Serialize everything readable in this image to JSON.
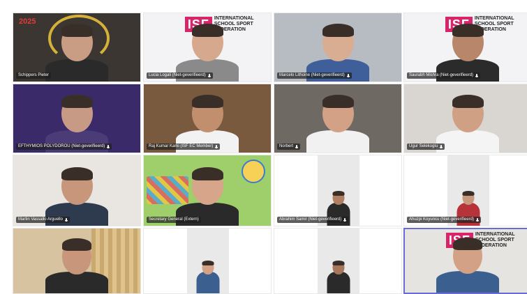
{
  "participants": [
    {
      "name": "Schippers Pieter",
      "mic": false,
      "muted": false,
      "bg": "#3b3632",
      "skin": "#c99d84",
      "shirt": "#2a2a2a",
      "overlay": "2025"
    },
    {
      "name": "Lucia Logali (Niet-geverifieerd)",
      "mic": true,
      "bg": "#f3f2f4",
      "skin": "#d6a98e",
      "shirt": "#8a8a8a",
      "isf": true
    },
    {
      "name": "Marcelo Lithoine (Niet-geverifieerd)",
      "mic": true,
      "bg": "#b7bcc3",
      "skin": "#d9ad92",
      "shirt": "#3f5f9a"
    },
    {
      "name": "Saurabh Mishra (Niet-geverifieerd)",
      "mic": true,
      "bg": "#f3f2f4",
      "skin": "#b8866a",
      "shirt": "#2b2b2b",
      "isf": true
    },
    {
      "name": "EFTHYMIOS POLYDOROU (Niet-geverifieerd)",
      "mic": true,
      "bg": "#3a2a6a",
      "skin": "#c79a86",
      "shirt": "#4b3c78"
    },
    {
      "name": "Raj Kumar Karki (ISF EC Member)",
      "mic": true,
      "bg": "#7a5a3e",
      "skin": "#c28f6e",
      "shirt": "#f2f2f2"
    },
    {
      "name": "Norbert",
      "mic": true,
      "bg": "#6e6a63",
      "skin": "#d3a286",
      "shirt": "#f1f1f1"
    },
    {
      "name": "Ugur Selekoglu",
      "mic": true,
      "bg": "#d9d5d0",
      "skin": "#d0a084",
      "shirt": "#f4f4f4"
    },
    {
      "name": "Martin Vassallo Arguello",
      "mic": true,
      "bg": "#e9e6e1",
      "skin": "#c8977b",
      "shirt": "#2e3b4f"
    },
    {
      "name": "Secretary General (Extern)",
      "mic": false,
      "bg": "#9fcf6a",
      "skin": "#d6a58a",
      "shirt": "#2a2a2a",
      "sticker": true
    },
    {
      "name": "Abrahim Samir (Niet-geverifieerd)",
      "mic": true,
      "bg": "#ffffff",
      "skin": "#b07f62",
      "shirt": "#2a2a2a",
      "inset": true
    },
    {
      "name": "Ahuzpi Koyuncu (Niet-geverifieerd)",
      "mic": true,
      "bg": "#ffffff",
      "skin": "#c8987c",
      "shirt": "#b8323a",
      "inset": true
    },
    {
      "name": "",
      "mic": false,
      "bg": "#d8c3a0",
      "skin": "#c8977b",
      "shirt": "#2a2a2a",
      "curtain": true
    },
    {
      "name": "",
      "mic": false,
      "bg": "#ffffff",
      "skin": "#d3a286",
      "shirt": "#3b5f8f",
      "inset": true
    },
    {
      "name": "",
      "mic": false,
      "bg": "#ffffff",
      "skin": "#a8765a",
      "shirt": "#2a2a2a",
      "inset": true
    },
    {
      "name": "",
      "mic": false,
      "bg": "#e6e4e1",
      "skin": "#d3a286",
      "shirt": "#3b5f8f",
      "active": true,
      "isf": true
    }
  ],
  "isf_brand": {
    "logo": "ISF",
    "text": [
      "INTERNATIONAL",
      "SCHOOL SPORT",
      "FEDERATION"
    ],
    "color": "#d8246b"
  },
  "overlay_text": "2025"
}
